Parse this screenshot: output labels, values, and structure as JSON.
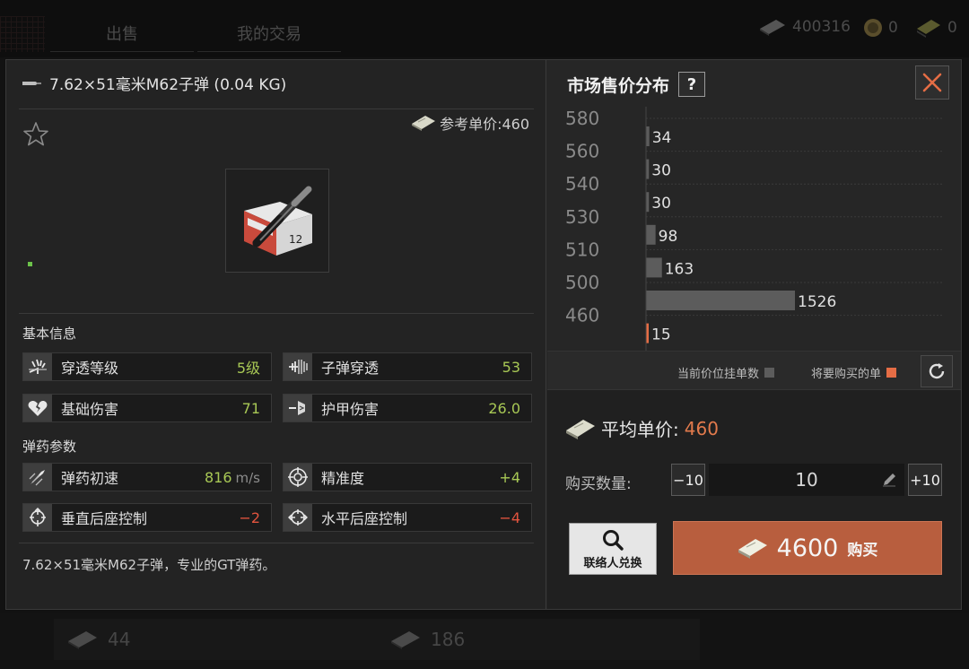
{
  "background": {
    "tabs": [
      "出售",
      "我的交易"
    ],
    "currency": [
      {
        "icon": "cash-icon",
        "value": "400316"
      },
      {
        "icon": "coin-icon",
        "value": "0"
      },
      {
        "icon": "token-icon",
        "value": "0"
      }
    ],
    "cards": [
      {
        "icon": "cash-icon",
        "value": "44"
      },
      {
        "icon": "cash-icon",
        "value": "186"
      }
    ]
  },
  "item": {
    "title": "7.62×51毫米M62子弹 (0.04 KG)",
    "ref_price_label": "参考单价:460",
    "basic_info_label": "基本信息",
    "ammo_params_label": "弹药参数",
    "stats_basic": [
      {
        "icon": "penetration-level-icon",
        "name": "穿透等级",
        "value": "5级",
        "color": "#a8c855"
      },
      {
        "icon": "bullet-penetration-icon",
        "name": "子弹穿透",
        "value": "53",
        "color": "#a8c855"
      },
      {
        "icon": "broken-heart-icon",
        "name": "基础伤害",
        "value": "71",
        "color": "#a8c855"
      },
      {
        "icon": "armor-damage-icon",
        "name": "护甲伤害",
        "value": "26.0",
        "color": "#a8c855"
      }
    ],
    "stats_ammo": [
      {
        "icon": "muzzle-velocity-icon",
        "name": "弹药初速",
        "value": "816",
        "unit": "m/s",
        "color": "#a8c855"
      },
      {
        "icon": "crosshair-icon",
        "name": "精准度",
        "value": "+4",
        "color": "#a8c855"
      },
      {
        "icon": "vertical-recoil-icon",
        "name": "垂直后座控制",
        "value": "−2",
        "color": "#e2543e"
      },
      {
        "icon": "horizontal-recoil-icon",
        "name": "水平后座控制",
        "value": "−4",
        "color": "#e2543e"
      }
    ],
    "description": "7.62×51毫米M62子弹，专业的GT弹药。"
  },
  "market": {
    "title": "市场售价分布",
    "help_label": "?",
    "legend_current": "当前价位挂单数",
    "legend_buy": "将要购买的单",
    "avg_label": "平均单价:",
    "avg_value": "460",
    "qty_label": "购买数量:",
    "minus_label": "−10",
    "plus_label": "+10",
    "qty_value": "10",
    "contact_label": "联络人兑换",
    "buy_amount": "4600",
    "buy_label": "购买"
  },
  "chart_data": {
    "type": "bar",
    "orientation": "horizontal",
    "title": "",
    "xlabel": "",
    "ylabel": "",
    "categories": [
      "580",
      "560",
      "540",
      "530",
      "510",
      "500",
      "460"
    ],
    "values": [
      34,
      30,
      30,
      98,
      163,
      1526,
      15
    ],
    "highlight_category": "460",
    "colors": {
      "current": "#5c5c5c",
      "buy": "#e56d45"
    }
  }
}
